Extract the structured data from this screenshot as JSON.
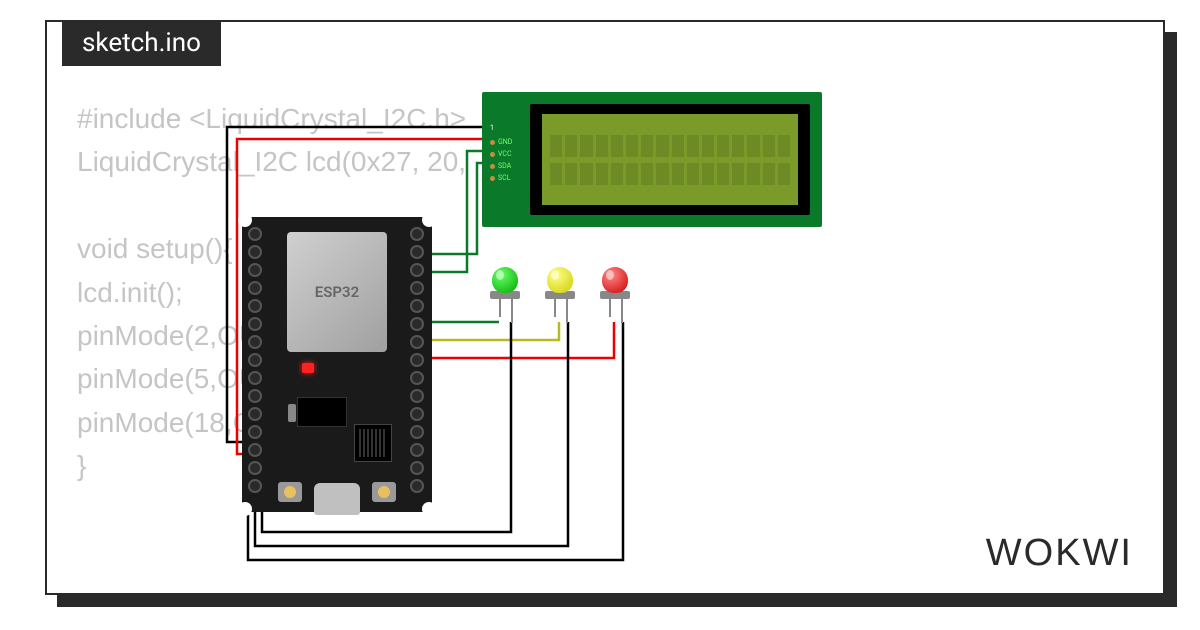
{
  "tab": {
    "filename": "sketch.ino"
  },
  "code": {
    "line1": "#include <LiquidCrystal_I2C.h>",
    "line2": "LiquidCrystal_I2C lcd(0x27, 20,",
    "line3": "",
    "line4": "void setup(){",
    "line5": "lcd.init();",
    "line6": "pinMode(2,OUT",
    "line7": "pinMode(5,OUT",
    "line8": "pinMode(18,O",
    "line9": "}"
  },
  "board": {
    "label": "ESP32"
  },
  "lcd": {
    "pins": [
      "GND",
      "VCC",
      "SDA",
      "SCL"
    ]
  },
  "leds": [
    {
      "name": "green",
      "color": "#0a0"
    },
    {
      "name": "yellow",
      "color": "#cc0"
    },
    {
      "name": "red",
      "color": "#c00"
    }
  ],
  "wires": {
    "colors": {
      "gnd": "#000000",
      "vcc": "#ff0000",
      "sda": "#008000",
      "scl": "#008000",
      "led_green": "#008000",
      "led_yellow": "#c0c000",
      "led_red": "#ff0000"
    }
  },
  "branding": {
    "logo": "WOKWI"
  }
}
